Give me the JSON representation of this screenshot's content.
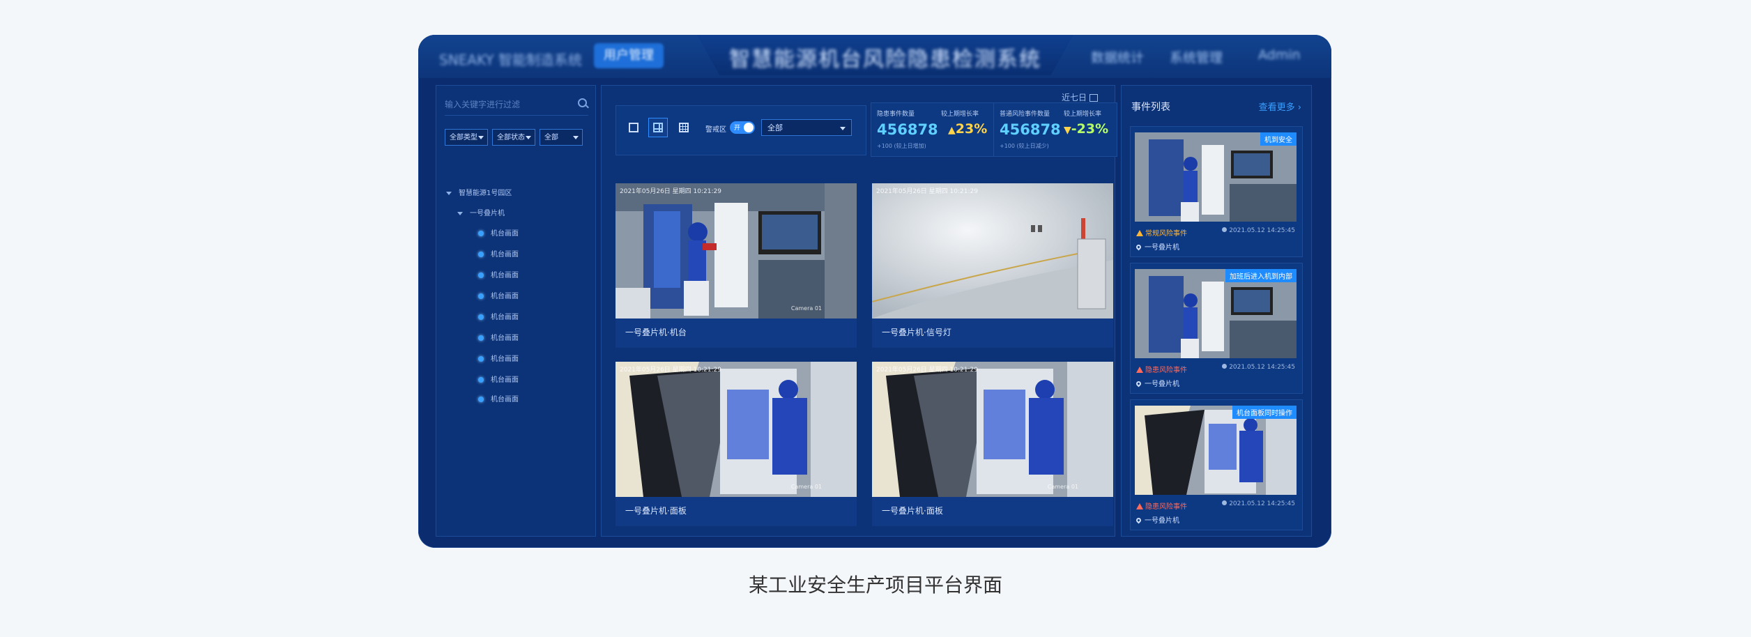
{
  "header": {
    "left_text": "SNEAKY 智能制造系统",
    "active_button": "用户管理",
    "title": "智慧能源机台风险隐患检测系统",
    "right_items": [
      "数据统计",
      "系统管理",
      "Admin"
    ]
  },
  "sidebar": {
    "search_placeholder": "输入关键字进行过滤",
    "filters": [
      "全部类型",
      "全部状态",
      "全部"
    ],
    "tree_root": "智慧能源1号园区",
    "tree_child": "一号叠片机",
    "leaves": [
      "机台画面",
      "机台画面",
      "机台画面",
      "机台画面",
      "机台画面",
      "机台画面",
      "机台画面",
      "机台画面",
      "机台画面"
    ]
  },
  "toolbar": {
    "alert_label": "警戒区",
    "toggle_text": "开",
    "dropdown_value": "全部"
  },
  "stats": {
    "range_label": "近七日",
    "card1": {
      "label_left": "隐患事件数量",
      "label_right": "较上期增长率",
      "value": "456878",
      "change": "23%",
      "sub": "+100 (较上日增加)",
      "change_color": "#ffd34a"
    },
    "card2": {
      "label_left": "普通风险事件数量",
      "label_right": "较上期增长率",
      "value": "456878",
      "change": "-23%",
      "sub": "+100 (较上日减少)",
      "change_color": "#ffd34a"
    }
  },
  "cameras": [
    {
      "caption": "一号叠片机·机台",
      "timestamp": "2021年05月26日 星期四 10:21:29",
      "cam": "Camera 01"
    },
    {
      "caption": "一号叠片机·信号灯",
      "timestamp": "2021年05月26日 星期四 10:21:29",
      "cam": ""
    },
    {
      "caption": "一号叠片机·面板",
      "timestamp": "2021年05月26日 星期四 10:21:29",
      "cam": "Camera 01"
    },
    {
      "caption": "一号叠片机·面板",
      "timestamp": "2021年05月26日 星期四 10:21:29",
      "cam": "Camera 01"
    }
  ],
  "events": {
    "title": "事件列表",
    "more": "查看更多",
    "items": [
      {
        "tag": "机到安全",
        "level": "常规风险事件",
        "level_color": "#ffb637",
        "time": "2021.05.12 14:25:45",
        "device": "一号叠片机"
      },
      {
        "tag": "加班后进入机到内部",
        "level": "隐患风险事件",
        "level_color": "#ff6a5a",
        "time": "2021.05.12 14:25:45",
        "device": "一号叠片机"
      },
      {
        "tag": "机台面板同时操作",
        "level": "隐患风险事件",
        "level_color": "#ff6a5a",
        "time": "2021.05.12 14:25:45",
        "device": "一号叠片机"
      }
    ]
  },
  "caption": "某工业安全生产项目平台界面"
}
